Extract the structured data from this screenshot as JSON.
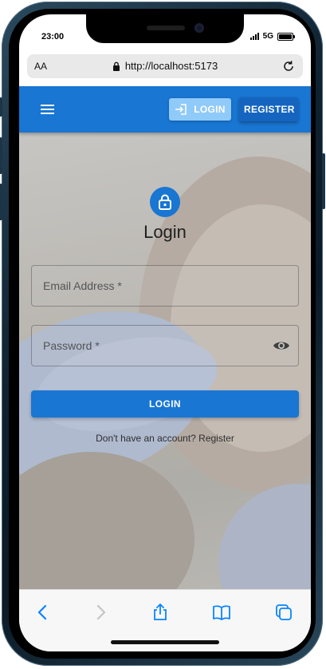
{
  "status_bar": {
    "time": "23:00",
    "network": "5G"
  },
  "browser": {
    "text_size_label": "AA",
    "url": "http://localhost:5173"
  },
  "app_bar": {
    "login_label": "LOGIN",
    "register_label": "REGISTER"
  },
  "login_form": {
    "title": "Login",
    "email_placeholder": "Email Address *",
    "password_placeholder": "Password *",
    "submit_label": "LOGIN",
    "register_link": "Don't have an account? Register"
  },
  "colors": {
    "primary": "#1976d2",
    "primary_dark": "#1565c0",
    "primary_light": "#90caf9",
    "ios_blue": "#0a84ff"
  },
  "icons": {
    "menu": "menu-icon",
    "login": "login-icon",
    "lock": "lock-icon",
    "eye": "visibility-icon",
    "back": "back-chevron-icon",
    "forward": "forward-chevron-icon",
    "share": "share-icon",
    "bookmarks": "book-icon",
    "tabs": "tabs-icon"
  }
}
